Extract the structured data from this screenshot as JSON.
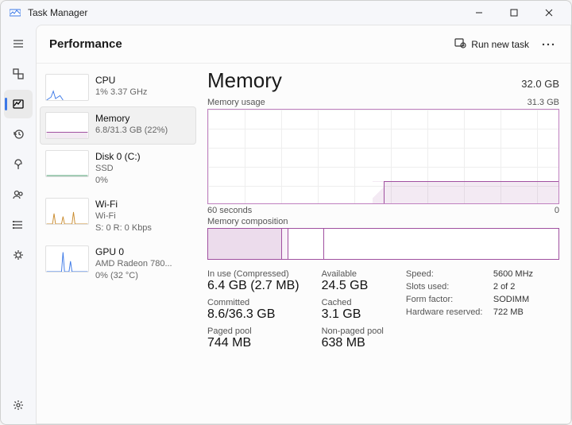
{
  "window": {
    "title": "Task Manager"
  },
  "rail": {
    "items": [
      {
        "name": "menu",
        "active": false
      },
      {
        "name": "processes",
        "active": false
      },
      {
        "name": "performance",
        "active": true
      },
      {
        "name": "history",
        "active": false
      },
      {
        "name": "startup",
        "active": false
      },
      {
        "name": "users",
        "active": false
      },
      {
        "name": "details",
        "active": false
      },
      {
        "name": "services",
        "active": false
      }
    ],
    "footer": {
      "name": "settings"
    }
  },
  "header": {
    "title": "Performance",
    "run_task": "Run new task",
    "more": "..."
  },
  "resources": [
    {
      "name": "CPU",
      "sub1": "1%  3.37 GHz",
      "sub2": "",
      "color": "#3b78e7"
    },
    {
      "name": "Memory",
      "sub1": "6.8/31.3 GB (22%)",
      "sub2": "",
      "color": "#a050a0",
      "selected": true
    },
    {
      "name": "Disk 0 (C:)",
      "sub1": "SSD",
      "sub2": "0%",
      "color": "#2e8b57"
    },
    {
      "name": "Wi-Fi",
      "sub1": "Wi-Fi",
      "sub2": "S: 0  R: 0 Kbps",
      "color": "#c98b2e"
    },
    {
      "name": "GPU 0",
      "sub1": "AMD Radeon 780...",
      "sub2": "0% (32 °C)",
      "color": "#3b78e7"
    }
  ],
  "detail": {
    "title": "Memory",
    "total": "32.0 GB",
    "usage_label": "Memory usage",
    "usage_max": "31.3 GB",
    "time_left": "60 seconds",
    "time_right": "0",
    "comp_label": "Memory composition",
    "stats": {
      "in_use_label": "In use (Compressed)",
      "in_use": "6.4 GB (2.7 MB)",
      "available_label": "Available",
      "available": "24.5 GB",
      "committed_label": "Committed",
      "committed": "8.6/36.3 GB",
      "cached_label": "Cached",
      "cached": "3.1 GB",
      "paged_label": "Paged pool",
      "paged": "744 MB",
      "nonpaged_label": "Non-paged pool",
      "nonpaged": "638 MB"
    },
    "hw": {
      "speed_k": "Speed:",
      "speed_v": "5600 MHz",
      "slots_k": "Slots used:",
      "slots_v": "2 of 2",
      "form_k": "Form factor:",
      "form_v": "SODIMM",
      "hwres_k": "Hardware reserved:",
      "hwres_v": "722 MB"
    }
  },
  "chart_data": {
    "type": "area",
    "title": "Memory usage",
    "x_label": "seconds",
    "x_range": [
      60,
      0
    ],
    "y_label": "GB",
    "ylim": [
      0,
      31.3
    ],
    "series": [
      {
        "name": "In use",
        "values_gb": [
          0,
          0,
          0,
          0,
          0,
          0,
          6.8,
          6.8,
          6.8,
          6.8,
          6.8,
          6.8
        ]
      }
    ],
    "composition": {
      "in_use_gb": 6.4,
      "modified_gb": 0.7,
      "standby_gb": 3.1,
      "free_gb": 21.1,
      "total_gb": 31.3
    }
  }
}
